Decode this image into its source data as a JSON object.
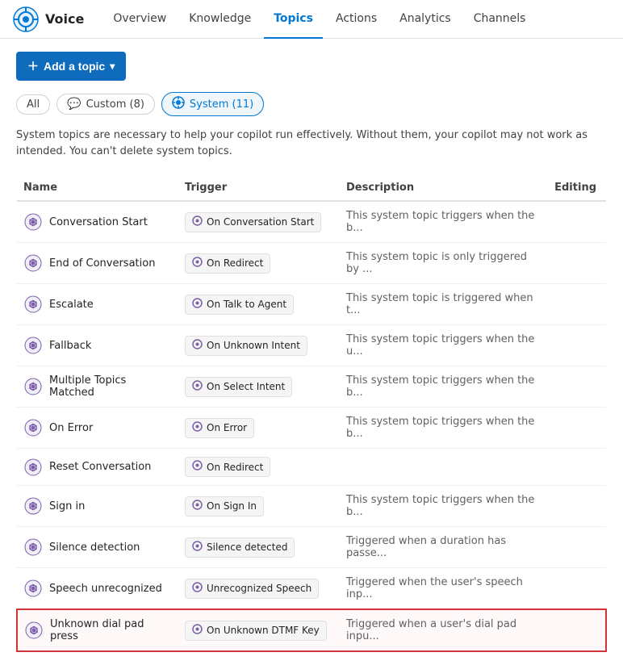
{
  "app": {
    "logo_alt": "Voice",
    "name": "Voice"
  },
  "nav": {
    "links": [
      {
        "label": "Overview",
        "active": false
      },
      {
        "label": "Knowledge",
        "active": false
      },
      {
        "label": "Topics",
        "active": true
      },
      {
        "label": "Actions",
        "active": false
      },
      {
        "label": "Analytics",
        "active": false
      },
      {
        "label": "Channels",
        "active": false
      }
    ]
  },
  "toolbar": {
    "add_button": "+ Add a topic ∨"
  },
  "filters": [
    {
      "label": "All",
      "active": false,
      "icon": ""
    },
    {
      "label": "Custom (8)",
      "active": false,
      "icon": "💬"
    },
    {
      "label": "System (11)",
      "active": true,
      "icon": "⚙"
    }
  ],
  "info": {
    "text": "System topics are necessary to help your copilot run effectively. Without them, your copilot may not work as intended. You can't delete system topics."
  },
  "table": {
    "headers": [
      "Name",
      "Trigger",
      "Description",
      "Editing"
    ],
    "rows": [
      {
        "name": "Conversation Start",
        "trigger": "On Conversation Start",
        "description": "This system topic triggers when the b...",
        "highlighted": false
      },
      {
        "name": "End of Conversation",
        "trigger": "On Redirect",
        "description": "This system topic is only triggered by ...",
        "highlighted": false
      },
      {
        "name": "Escalate",
        "trigger": "On Talk to Agent",
        "description": "This system topic is triggered when t...",
        "highlighted": false
      },
      {
        "name": "Fallback",
        "trigger": "On Unknown Intent",
        "description": "This system topic triggers when the u...",
        "highlighted": false
      },
      {
        "name": "Multiple Topics Matched",
        "trigger": "On Select Intent",
        "description": "This system topic triggers when the b...",
        "highlighted": false
      },
      {
        "name": "On Error",
        "trigger": "On Error",
        "description": "This system topic triggers when the b...",
        "highlighted": false
      },
      {
        "name": "Reset Conversation",
        "trigger": "On Redirect",
        "description": "",
        "highlighted": false
      },
      {
        "name": "Sign in",
        "trigger": "On Sign In",
        "description": "This system topic triggers when the b...",
        "highlighted": false
      },
      {
        "name": "Silence detection",
        "trigger": "Silence detected",
        "description": "Triggered when a duration has passe...",
        "highlighted": false
      },
      {
        "name": "Speech unrecognized",
        "trigger": "Unrecognized Speech",
        "description": "Triggered when the user's speech inp...",
        "highlighted": false
      },
      {
        "name": "Unknown dial pad press",
        "trigger": "On Unknown DTMF Key",
        "description": "Triggered when a user's dial pad inpu...",
        "highlighted": true
      }
    ]
  }
}
